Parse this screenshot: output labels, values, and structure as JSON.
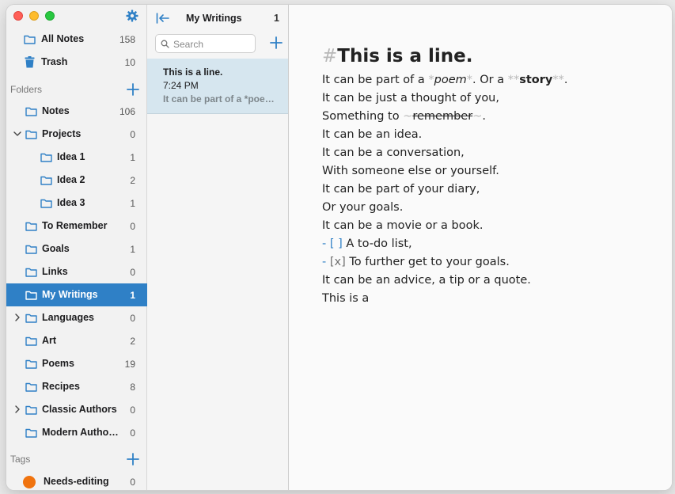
{
  "sidebar": {
    "library": [
      {
        "label": "All Notes",
        "count": "158",
        "icon": "folder-icon"
      },
      {
        "label": "Trash",
        "count": "10",
        "icon": "trash-icon"
      }
    ],
    "folders_label": "Folders",
    "folders": [
      {
        "label": "Notes",
        "count": "106"
      },
      {
        "label": "Projects",
        "count": "0",
        "expanded": true
      },
      {
        "label": "Idea 1",
        "count": "1"
      },
      {
        "label": "Idea 2",
        "count": "2"
      },
      {
        "label": "Idea 3",
        "count": "1"
      },
      {
        "label": "To Remember",
        "count": "0"
      },
      {
        "label": "Goals",
        "count": "1"
      },
      {
        "label": "Links",
        "count": "0"
      },
      {
        "label": "My Writings",
        "count": "1",
        "selected": true
      },
      {
        "label": "Languages",
        "count": "0",
        "collapsed": true
      },
      {
        "label": "Art",
        "count": "2"
      },
      {
        "label": "Poems",
        "count": "19"
      },
      {
        "label": "Recipes",
        "count": "8"
      },
      {
        "label": "Classic Authors",
        "count": "0",
        "collapsed": true
      },
      {
        "label": "Modern Autho…",
        "count": "0"
      }
    ],
    "tags_label": "Tags",
    "tags": [
      {
        "label": "Needs-editing",
        "count": "0",
        "color": "#f0730e"
      }
    ]
  },
  "note_list": {
    "title": "My Writings",
    "count": "1",
    "search_placeholder": "Search",
    "notes": [
      {
        "title": "This is a line.",
        "time": "7:24 PM",
        "preview": "It can be part of a *poe…"
      }
    ]
  },
  "editor": {
    "heading_marker": "#",
    "heading": "This is a line.",
    "lines": {
      "l1_a": "It can be part of a ",
      "l1_m1": "*",
      "l1_poem": "poem",
      "l1_m2": "*",
      "l1_b": ". Or a ",
      "l1_m3": "**",
      "l1_story": "story",
      "l1_m4": "**",
      "l1_c": ".",
      "l2": "It can be just a thought of you,",
      "l3_a": "Something to ",
      "l3_m1": "~",
      "l3_remember": "remember",
      "l3_m2": "~",
      "l3_b": ".",
      "l4": "It can be an idea.",
      "l5": "It can be a conversation,",
      "l6": "With someone else or yourself.",
      "l7": "It can be part of your diary,",
      "l8": "Or your goals.",
      "l9": "It can be a movie or a book.",
      "l10_marker": "- [ ]",
      "l10_text": " A to-do list,",
      "l11_dash": "-",
      "l11_box": " [x]",
      "l11_text": " To further get to your goals.",
      "l12": "It can be an advice, a tip or a quote.",
      "l13": "This is a"
    }
  },
  "colors": {
    "accent": "#2f80c6",
    "selected_note_bg": "#d6e6ef",
    "markdown_marker": "#b8b8b8"
  }
}
